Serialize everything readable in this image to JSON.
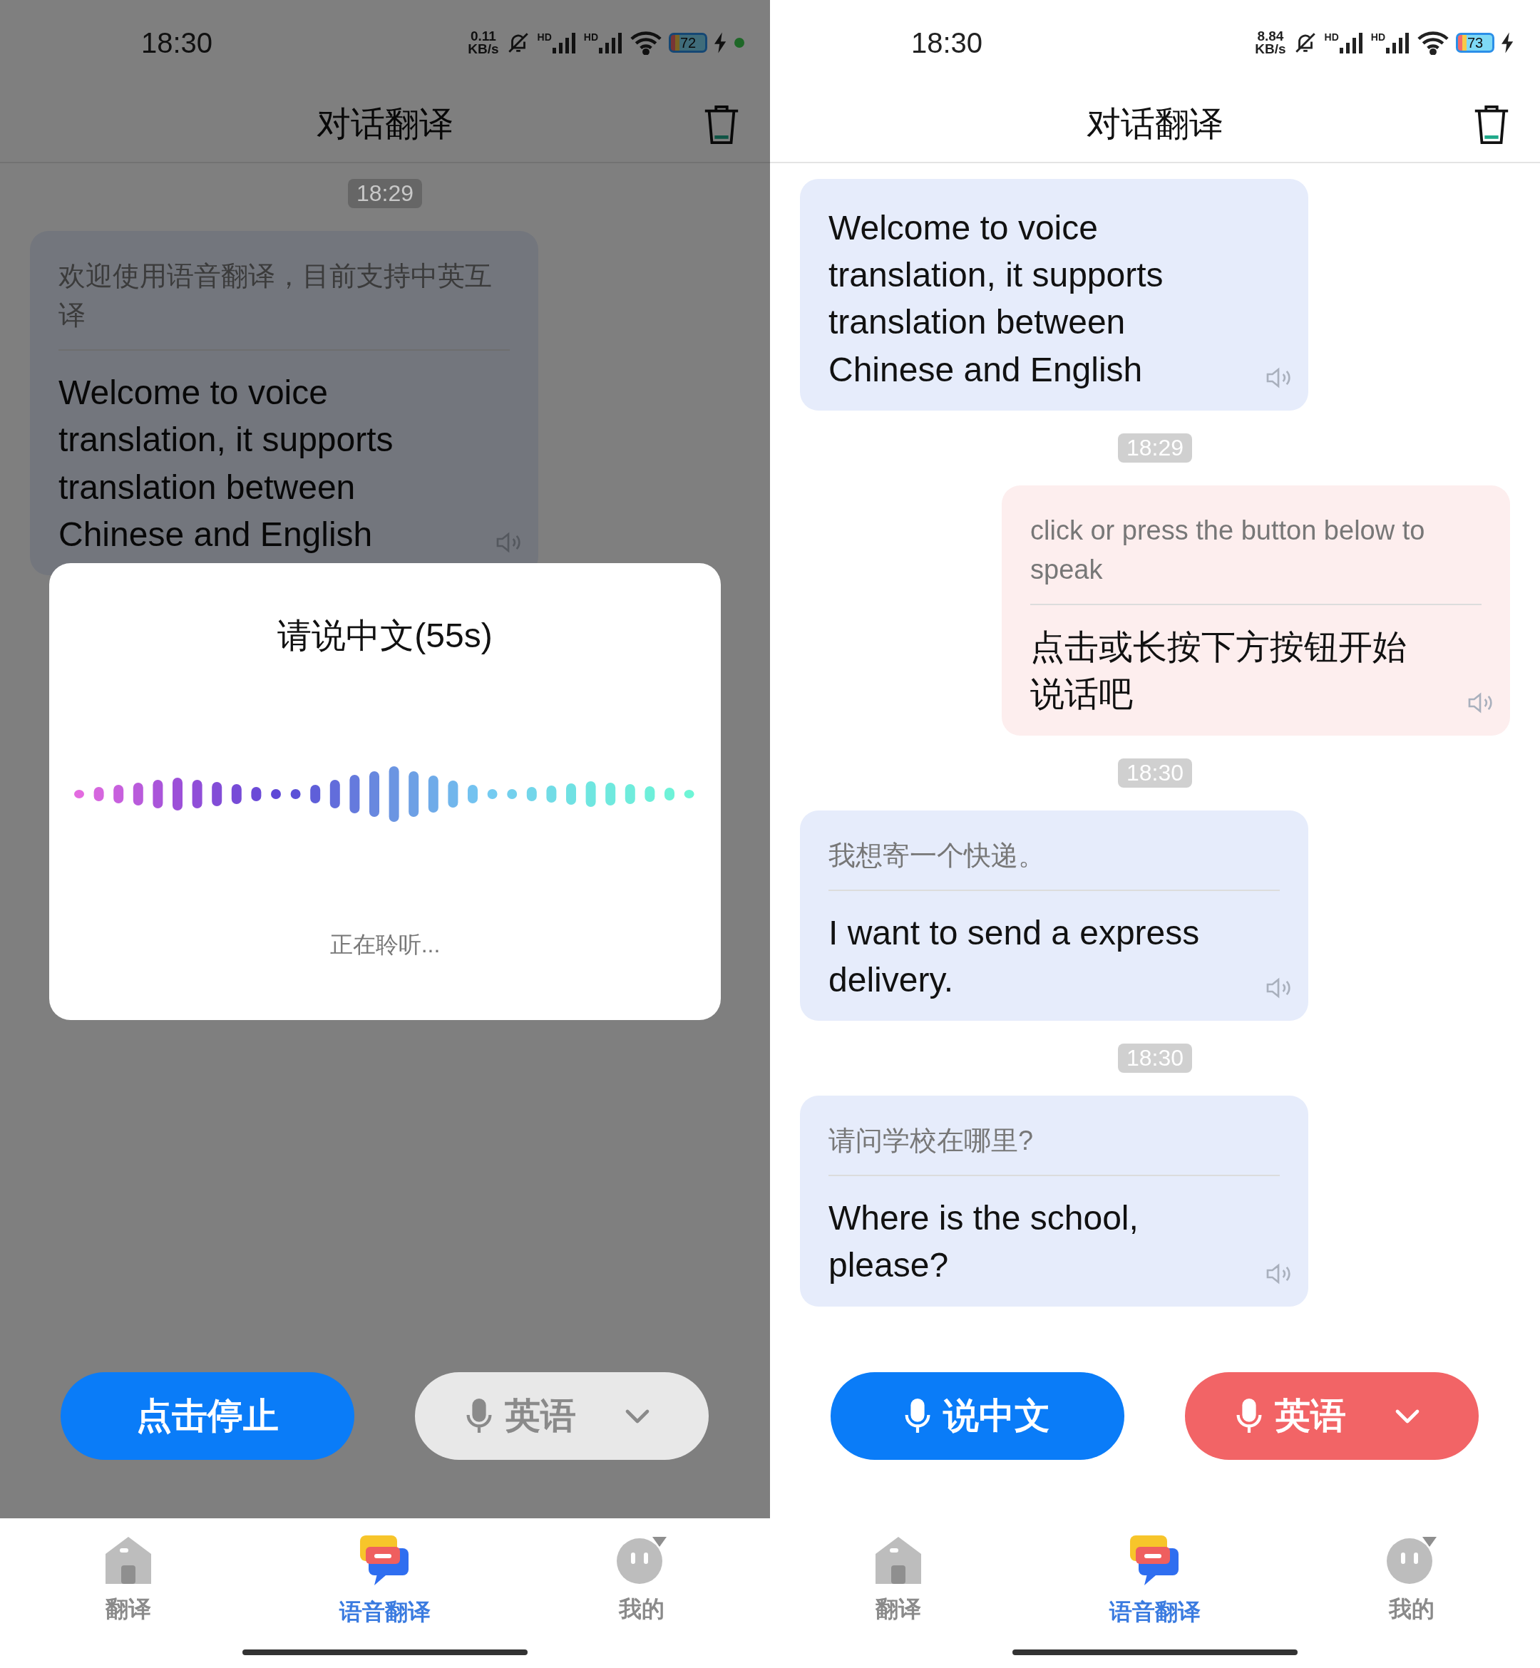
{
  "screens": [
    {
      "status_bar": {
        "time": "18:30",
        "net_speed_value": "0.11",
        "net_speed_unit": "KB/s",
        "signals": [
          {
            "label": "HD"
          },
          {
            "label": "HD"
          }
        ],
        "battery": "72",
        "charging": true,
        "privacy_dot": true
      },
      "header": {
        "title": "对话翻译"
      },
      "messages": [
        {
          "kind": "time",
          "text": "18:29"
        },
        {
          "kind": "received",
          "source": "欢迎使用语音翻译，目前支持中英互译",
          "translation": "Welcome to voice translation, it supports translation between Chinese and English"
        }
      ],
      "listening_dialog": {
        "title": "请说中文(55s)",
        "status": "正在聆听..."
      },
      "buttons": [
        {
          "kind": "primary",
          "label": "点击停止",
          "mic": false,
          "dropdown": false,
          "disabled": false
        },
        {
          "kind": "secondary",
          "label": "英语",
          "mic": true,
          "dropdown": true,
          "disabled": true
        }
      ],
      "tabs": [
        {
          "kind": "home",
          "label": "翻译",
          "selected": false
        },
        {
          "kind": "chat",
          "label": "语音翻译",
          "selected": true
        },
        {
          "kind": "profile",
          "label": "我的",
          "selected": false
        }
      ]
    },
    {
      "status_bar": {
        "time": "18:30",
        "net_speed_value": "8.84",
        "net_speed_unit": "KB/s",
        "signals": [
          {
            "label": "HD"
          },
          {
            "label": "HD"
          }
        ],
        "battery": "73",
        "charging": true,
        "privacy_dot": false
      },
      "header": {
        "title": "对话翻译"
      },
      "messages": [
        {
          "kind": "received",
          "translation": "Welcome to voice translation, it supports translation between Chinese and English"
        },
        {
          "kind": "time",
          "text": "18:29"
        },
        {
          "kind": "sent",
          "source": "click or press the button below to speak",
          "translation": "点击或长按下方按钮开始说话吧"
        },
        {
          "kind": "time",
          "text": "18:30"
        },
        {
          "kind": "received",
          "source": "我想寄一个快递。",
          "translation": "I want to send a express delivery."
        },
        {
          "kind": "time",
          "text": "18:30"
        },
        {
          "kind": "received",
          "source": "请问学校在哪里?",
          "translation": "Where is the school, please?"
        }
      ],
      "buttons": [
        {
          "kind": "primary",
          "label": "说中文",
          "mic": true,
          "dropdown": false,
          "disabled": false
        },
        {
          "kind": "secondary",
          "label": "英语",
          "mic": true,
          "dropdown": true,
          "disabled": false
        }
      ],
      "tabs": [
        {
          "kind": "home",
          "label": "翻译",
          "selected": false
        },
        {
          "kind": "chat",
          "label": "语音翻译",
          "selected": true
        },
        {
          "kind": "profile",
          "label": "我的",
          "selected": false
        }
      ]
    }
  ]
}
